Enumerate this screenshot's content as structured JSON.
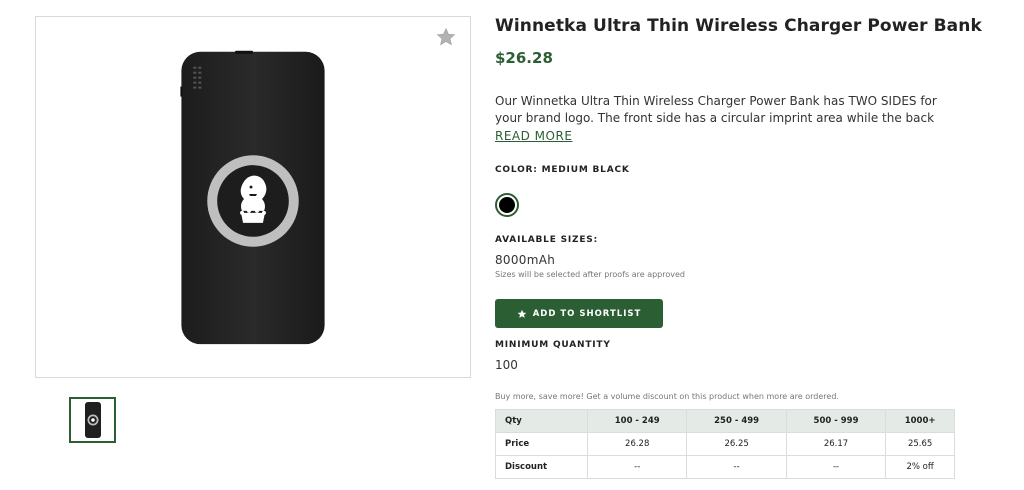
{
  "product": {
    "title": "Winnetka Ultra Thin Wireless Charger Power Bank",
    "price": "$26.28",
    "description": "Our Winnetka Ultra Thin Wireless Charger Power Bank has TWO SIDES for your brand logo. The front side has a circular imprint area while the back side has a larger impri...",
    "read_more": "READ MORE",
    "favorite_icon": "star-icon"
  },
  "color": {
    "label": "COLOR: MEDIUM BLACK",
    "swatch_color": "#000000"
  },
  "sizes": {
    "label": "AVAILABLE SIZES:",
    "value": "8000mAh",
    "note": "Sizes will be selected after proofs are approved"
  },
  "shortlist": {
    "label": "ADD TO SHORTLIST",
    "icon": "star-icon"
  },
  "minimum_quantity": {
    "label": "MINIMUM QUANTITY",
    "value": "100"
  },
  "volume": {
    "note": "Buy more, save more! Get a volume discount on this product when more are ordered.",
    "header": [
      "Qty",
      "100 - 249",
      "250 - 499",
      "500 - 999",
      "1000+"
    ],
    "price_row": [
      "Price",
      "26.28",
      "26.25",
      "26.17",
      "25.65"
    ],
    "discount_row": [
      "Discount",
      "--",
      "--",
      "--",
      "2% off"
    ]
  },
  "colors": {
    "brand_green": "#2c5e34",
    "table_header_bg": "#e4ebe7"
  }
}
